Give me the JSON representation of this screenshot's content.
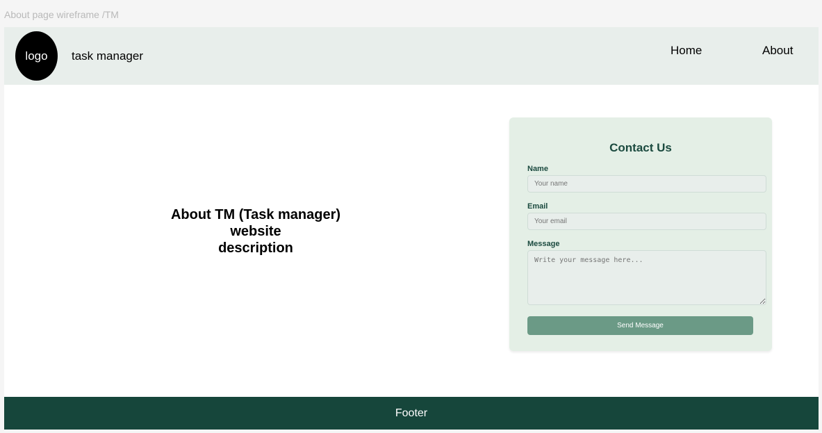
{
  "canvas_label": "About page wireframe /TM",
  "header": {
    "logo_text": "logo",
    "brand_name": "task manager",
    "nav": {
      "home": "Home",
      "about": "About"
    }
  },
  "about": {
    "line1": "About TM (Task manager)",
    "line2": "website",
    "line3": "description"
  },
  "contact": {
    "title": "Contact Us",
    "name_label": "Name",
    "name_placeholder": "Your name",
    "email_label": "Email",
    "email_placeholder": "Your email",
    "message_label": "Message",
    "message_placeholder": "Write your message here...",
    "send_label": "Send Message"
  },
  "footer": {
    "text": "Footer"
  },
  "colors": {
    "header_bg": "#e8eeeb",
    "card_bg": "#e4efe6",
    "accent_dark": "#16463b",
    "button_bg": "#6b9a86"
  }
}
